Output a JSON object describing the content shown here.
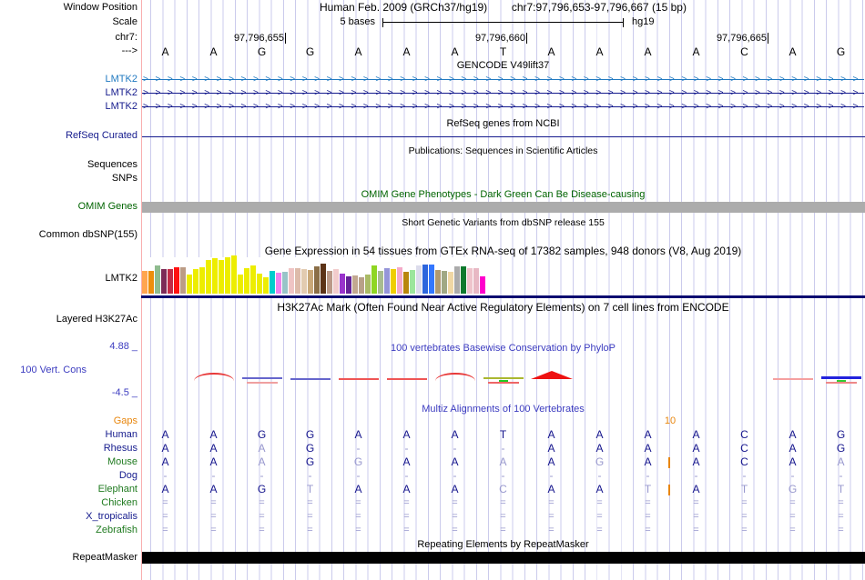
{
  "window": {
    "title_left": "Window Position",
    "assembly": "Human Feb. 2009 (GRCh37/hg19)",
    "position": "chr7:97,796,653-97,796,667 (15 bp)"
  },
  "scale": {
    "label": "Scale",
    "value": "5 bases",
    "assembly_short": "hg19"
  },
  "chrom": {
    "label": "chr7:",
    "ticks": [
      "97,796,655",
      "97,796,660",
      "97,796,665"
    ]
  },
  "sequence": {
    "strand_label": "--->",
    "bases": [
      "A",
      "A",
      "G",
      "G",
      "A",
      "A",
      "A",
      "T",
      "A",
      "A",
      "A",
      "A",
      "C",
      "A",
      "G"
    ]
  },
  "gencode": {
    "title": "GENCODE V49lift37",
    "arrow_char": ">",
    "arrow_count": 59,
    "genes": [
      {
        "label": "LMTK2",
        "color": "#2079C0"
      },
      {
        "label": "LMTK2",
        "color": "#151B8D"
      },
      {
        "label": "LMTK2",
        "color": "#151B8D"
      }
    ]
  },
  "refseq": {
    "title": "RefSeq genes from NCBI",
    "label": "RefSeq Curated",
    "line_color": "#151B8D"
  },
  "publications": {
    "title": "Publications: Sequences in Scientific Articles",
    "row_labels": [
      "Sequences",
      "SNPs"
    ]
  },
  "omim": {
    "title": "OMIM Gene Phenotypes - Dark Green Can Be Disease-causing",
    "label": "OMIM Genes",
    "bar_color": "#ACACAC"
  },
  "dbsnp": {
    "title": "Short Genetic Variants from dbSNP release 155",
    "label": "Common dbSNP(155)"
  },
  "gtex": {
    "title": "Gene Expression in 54 tissues from GTEx RNA-seq of 17382 samples, 948 donors (V8, Aug 2019)",
    "label": "LMTK2",
    "baseline_color": "#0B0B70"
  },
  "h3k27ac": {
    "title": "H3K27Ac Mark (Often Found Near Active Regulatory Elements) on 7 cell lines from ENCODE",
    "label": "Layered H3K27Ac"
  },
  "conservation": {
    "title": "100 vertebrates Basewise Conservation by PhyloP",
    "label": "100 Vert. Cons",
    "max_label": "4.88 _",
    "min_label": "-4.5 _",
    "accent": "#3C3CC0"
  },
  "multiz": {
    "title": "Multiz Alignments of 100 Vertebrates",
    "gaps_label": "Gaps",
    "gap_size_label": "10",
    "gap_color": "#E8860D",
    "insertions": [
      "Mouse",
      "Elephant"
    ],
    "rows": [
      {
        "name": "Human",
        "color": "#151B8D",
        "cells": [
          "A",
          "A",
          "G",
          "G",
          "A",
          "A",
          "A",
          "T",
          "A",
          "A",
          "A",
          "A",
          "C",
          "A",
          "G"
        ]
      },
      {
        "name": "Rhesus",
        "color": "#151B8D",
        "cells": [
          "A",
          "A",
          "a",
          "G",
          "-",
          "-",
          "-",
          "-",
          "A",
          "A",
          "A",
          "A",
          "C",
          "A",
          "G"
        ]
      },
      {
        "name": "Mouse",
        "color": "#1F7A1F",
        "cells": [
          "A",
          "A",
          "a",
          "G",
          "g",
          "A",
          "A",
          "a",
          "A",
          "g",
          "A",
          "A",
          "C",
          "A",
          "a"
        ]
      },
      {
        "name": "Dog",
        "color": "#151B8D",
        "cells": [
          "-",
          "-",
          "-",
          "-",
          "-",
          "-",
          "-",
          "-",
          "-",
          "-",
          "-",
          "-",
          "-",
          "-",
          "-"
        ]
      },
      {
        "name": "Elephant",
        "color": "#1F7A1F",
        "cells": [
          "A",
          "A",
          "G",
          "t",
          "A",
          "A",
          "A",
          "c",
          "A",
          "A",
          "t",
          "A",
          "t",
          "g",
          "t"
        ]
      },
      {
        "name": "Chicken",
        "color": "#1F7A1F",
        "cells": [
          "=",
          "=",
          "=",
          "=",
          "=",
          "=",
          "=",
          "=",
          "=",
          "=",
          "=",
          "=",
          "=",
          "=",
          "="
        ]
      },
      {
        "name": "X_tropicalis",
        "color": "#151B8D",
        "cells": [
          "=",
          "=",
          "=",
          "=",
          "=",
          "=",
          "=",
          "=",
          "=",
          "=",
          "=",
          "=",
          "=",
          "=",
          "="
        ]
      },
      {
        "name": "Zebrafish",
        "color": "#1F7A1F",
        "cells": [
          "=",
          "=",
          "=",
          "=",
          "=",
          "=",
          "=",
          "=",
          "=",
          "=",
          "=",
          "=",
          "=",
          "=",
          "="
        ]
      }
    ]
  },
  "repeat": {
    "title": "Repeating Elements by RepeatMasker",
    "label": "RepeatMasker",
    "bar_color": "#000000"
  },
  "chart_data": [
    {
      "type": "bar",
      "title": "Gene Expression in 54 tissues from GTEx RNA-seq of 17382 samples, 948 donors (V8, Aug 2019)",
      "gene": "LMTK2",
      "note": "54 tissue bars, axis unlabeled; values are bar heights in px",
      "values": [
        25,
        25,
        31,
        27,
        27,
        29,
        29,
        21,
        27,
        29,
        37,
        39,
        37,
        40,
        42,
        21,
        28,
        31,
        22,
        18,
        25,
        23,
        24,
        28,
        28,
        27,
        26,
        30,
        33,
        25,
        27,
        22,
        19,
        20,
        18,
        21,
        31,
        25,
        28,
        27,
        29,
        24,
        26,
        31,
        32,
        32,
        26,
        25,
        24,
        30,
        30,
        28,
        28,
        19
      ],
      "bar_colors": [
        "#FFA54F",
        "#EE8E0C",
        "#8FBC8F",
        "#7D2B57",
        "#C22B47",
        "#FF1111",
        "#BC9C85",
        "#EDED00",
        "#EDED00",
        "#EDED00",
        "#EDED00",
        "#EDED00",
        "#EDED00",
        "#EDED00",
        "#EDED00",
        "#EDED00",
        "#EDED00",
        "#EDED00",
        "#EDED00",
        "#EDED00",
        "#00CDCD",
        "#EE82EE",
        "#98C4C8",
        "#EFC4C4",
        "#DDBBAA",
        "#E2CBB0",
        "#C9A878",
        "#8B6F47",
        "#5C3317",
        "#BB9988",
        "#F2CCCC",
        "#9933CC",
        "#662299",
        "#C2A890",
        "#B8A088",
        "#AABB66",
        "#8FD622",
        "#A8BC90",
        "#9595D8",
        "#EECE00",
        "#F4AAC8",
        "#B8860B",
        "#9CE69C",
        "#DCDCEC",
        "#2E66DD",
        "#3377FF",
        "#B09A72",
        "#A0A884",
        "#EFD7A4",
        "#ABABAB",
        "#0E7A2E",
        "#EFC4CC",
        "#E8B8C4",
        "#FF00CC"
      ]
    },
    {
      "type": "line",
      "title": "100 vertebrates Basewise Conservation by PhyloP",
      "ylim": [
        -4.5,
        4.88
      ],
      "segments": [
        {
          "col": 2,
          "kind": "arc",
          "color": "#E83939"
        },
        {
          "col": 3,
          "kind": "mix",
          "color": "#6666CC",
          "under": "#EFA0A0"
        },
        {
          "col": 4,
          "kind": "line",
          "color": "#6666CC"
        },
        {
          "col": 5,
          "kind": "line",
          "color": "#EE5555"
        },
        {
          "col": 6,
          "kind": "line",
          "color": "#EE5555"
        },
        {
          "col": 7,
          "kind": "arc",
          "color": "#E83939"
        },
        {
          "col": 8,
          "kind": "mix",
          "color": "#AAB830",
          "tick": "#22CC22",
          "under": "#EE6666"
        },
        {
          "col": 9,
          "kind": "peak",
          "color": "#EE1111"
        },
        {
          "col": 14,
          "kind": "line",
          "color": "#F5A0A0"
        },
        {
          "col": 15,
          "kind": "mix",
          "color": "#2222DD",
          "tick": "#33CC33",
          "under": "#EE8888",
          "thick": true
        }
      ]
    }
  ]
}
